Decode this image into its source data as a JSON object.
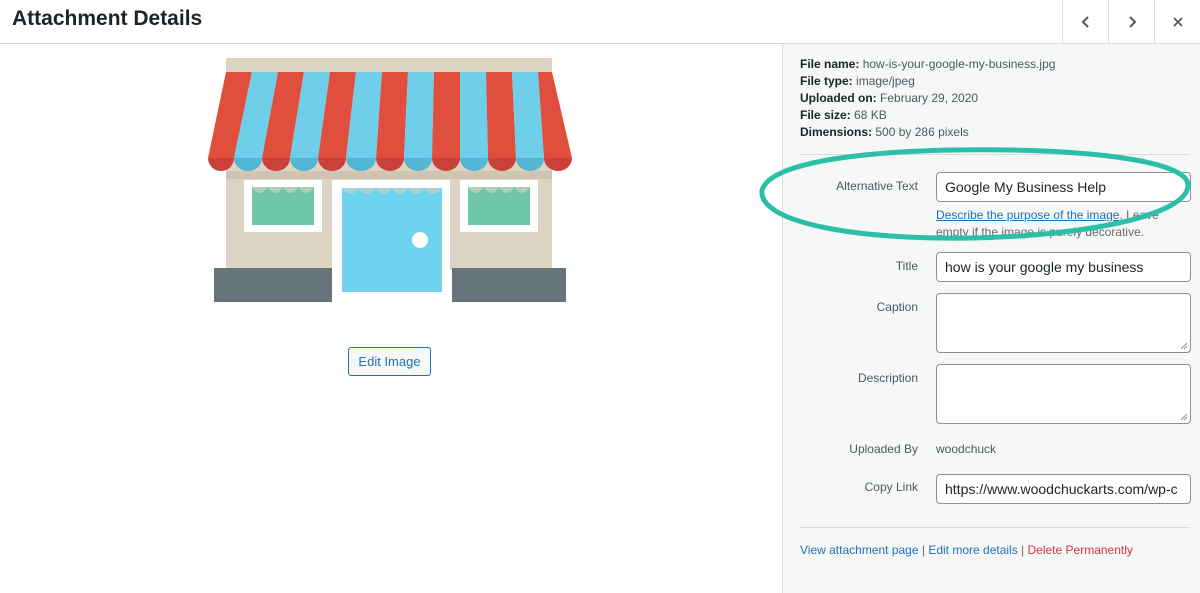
{
  "header": {
    "title": "Attachment Details",
    "prev_icon": "chevron-left-icon",
    "next_icon": "chevron-right-icon",
    "close_icon": "close-icon"
  },
  "preview": {
    "edit_label": "Edit Image",
    "image_subject": "storefront-illustration"
  },
  "file_info": {
    "name_label": "File name:",
    "name_value": "how-is-your-google-my-business.jpg",
    "type_label": "File type:",
    "type_value": "image/jpeg",
    "uploaded_label": "Uploaded on:",
    "uploaded_value": "February 29, 2020",
    "size_label": "File size:",
    "size_value": "68 KB",
    "dim_label": "Dimensions:",
    "dim_value": "500 by 286 pixels"
  },
  "fields": {
    "alt_label": "Alternative Text",
    "alt_value": "Google My Business Help",
    "alt_help_link": "Describe the purpose of the image",
    "alt_help_rest": ". Leave empty if the image is purely decorative.",
    "title_label": "Title",
    "title_value": "how is your google my business",
    "caption_label": "Caption",
    "caption_value": "",
    "desc_label": "Description",
    "desc_value": "",
    "uploaded_by_label": "Uploaded By",
    "uploaded_by_value": "woodchuck",
    "copy_link_label": "Copy Link",
    "copy_link_value": "https://www.woodchuckarts.com/wp-c"
  },
  "actions": {
    "view_page": "View attachment page",
    "divider": " | ",
    "edit_details": "Edit more details",
    "delete": "Delete Permanently"
  },
  "colors": {
    "highlight_ring": "#2bbfa8",
    "link": "#2271b1",
    "danger": "#d63638",
    "awning_red": "#e04f3e",
    "awning_blue": "#6fcfea"
  }
}
